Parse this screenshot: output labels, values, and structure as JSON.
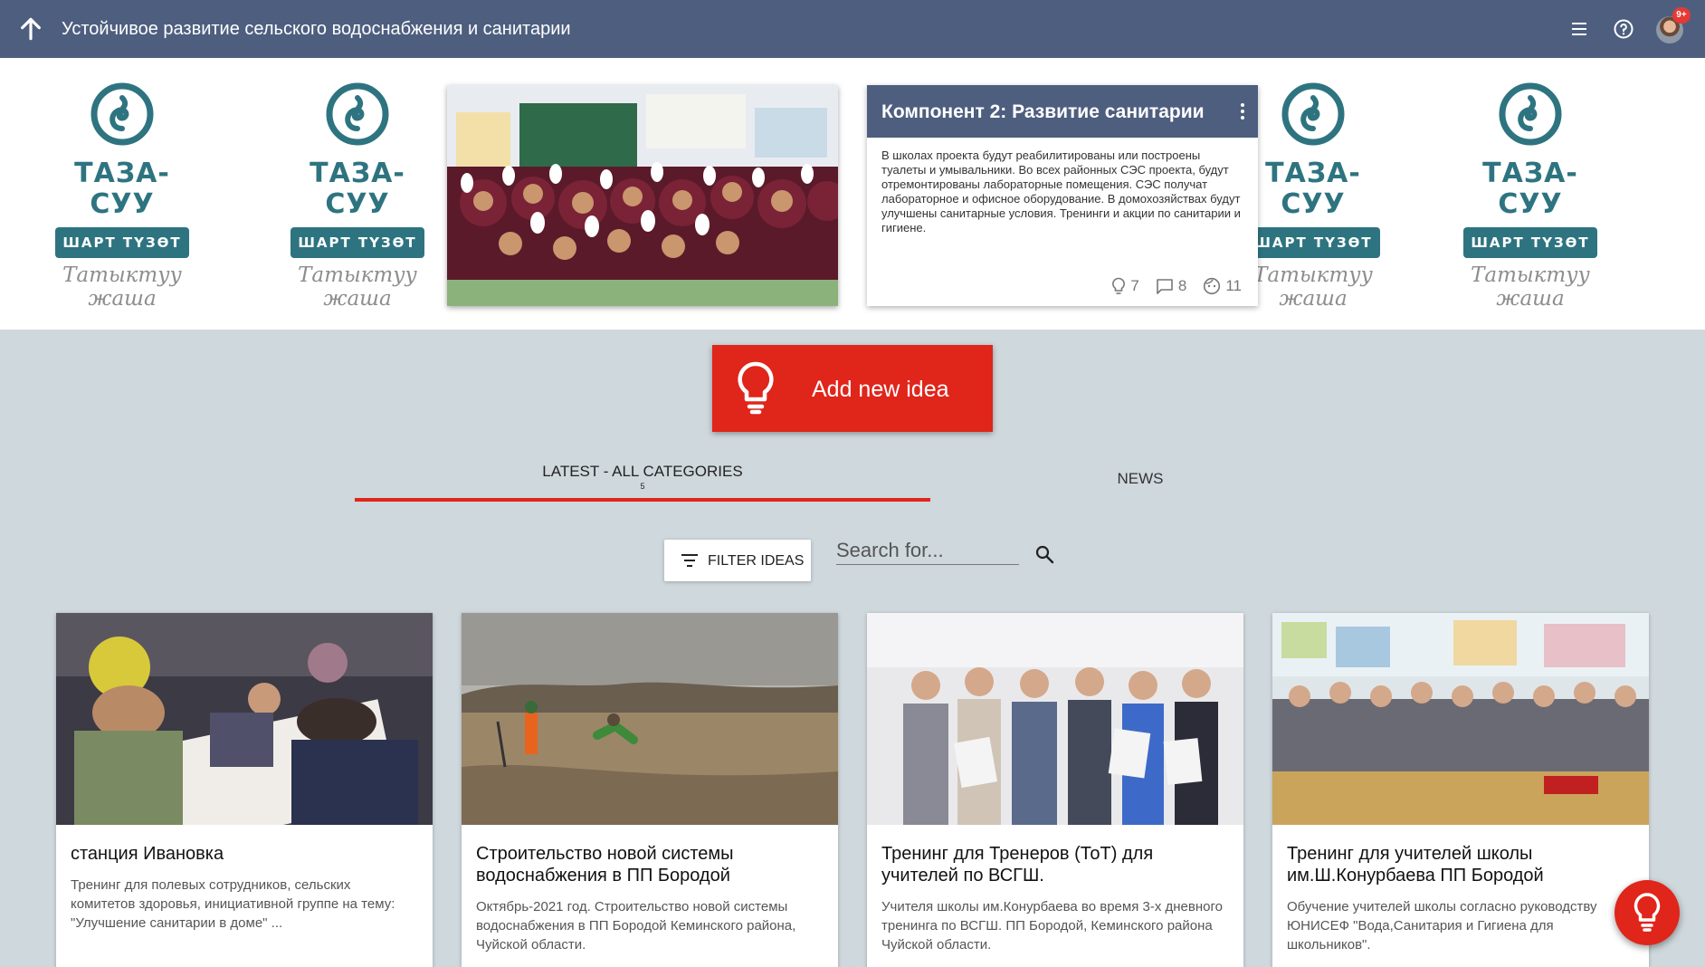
{
  "header": {
    "title": "Устойчивое развитие сельского водоснабжения и санитарии",
    "notification_badge": "9+"
  },
  "banner": {
    "logo": {
      "brand": "ТАЗА-СУУ",
      "tagline": "ШАРТ ТҮЗӨТ",
      "subtitle_line1": "Татыктуу",
      "subtitle_line2": "жаша",
      "color": "#2e7480"
    },
    "featured": {
      "title": "Компонент 2: Развитие санитарии",
      "description": "В школах проекта будут реабилитированы или построены туалеты и умывальники. Во всех районных СЭС проекта, будут отремонтированы лабораторные помещения. СЭС получат лабораторное и офисное оборудование. В домохозяйствах будут улучшены санитарные условия. Тренинги и акции по санитарии и гигиене.",
      "ideas_count": "7",
      "comments_count": "8",
      "participants_count": "11"
    }
  },
  "add_idea": {
    "label": "Add new idea"
  },
  "tabs": {
    "latest": {
      "label": "LATEST - ALL CATEGORIES",
      "count": "5"
    },
    "news": {
      "label": "NEWS"
    }
  },
  "filter": {
    "label": "FILTER IDEAS"
  },
  "search": {
    "placeholder": "Search for..."
  },
  "ideas": [
    {
      "title": "станция Ивановка",
      "description": "Тренинг для полевых сотрудников, сельских комитетов здоровья, инициативной группе на тему: \"Улучшение санитарии в доме\" ..."
    },
    {
      "title": "Строительство новой системы водоснабжения в ПП Бородой",
      "description": "Октябрь-2021 год. Строительство новой системы водоснабжения в ПП Бородой Кеминского района, Чуйской области."
    },
    {
      "title": "Тренинг для Тренеров (ТоТ) для учителей по ВСГШ.",
      "description": "Учителя школы им.Конурбаева во время 3-х дневного тренинга по ВСГШ. ПП Бородой, Кеминского района Чуйской области."
    },
    {
      "title": "Тренинг для учителей школы им.Ш.Конурбаева ПП Бородой",
      "description": "Обучение учителей школы согласно руководству ЮНИСЕФ \"Вода,Санитария и Гигиена для школьников\"."
    }
  ],
  "colors": {
    "header": "#4e5e7f",
    "accent": "#e0251b",
    "background": "#cfd8dc"
  }
}
